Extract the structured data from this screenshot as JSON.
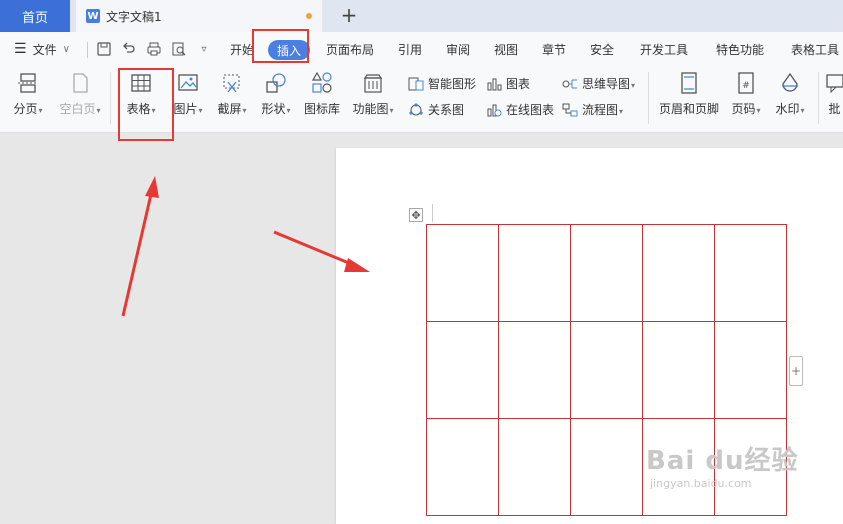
{
  "tabs": {
    "home": "首页",
    "doc_icon": "W",
    "doc_title": "文字文稿1",
    "add": "+"
  },
  "menubar": {
    "file_label": "文件",
    "items": [
      "开始",
      "插入",
      "页面布局",
      "引用",
      "审阅",
      "视图",
      "章节",
      "安全",
      "开发工具",
      "特色功能",
      "表格工具"
    ],
    "active_item": "插入"
  },
  "ribbon": {
    "page_break": "分页",
    "blank_page": "空白页",
    "table": "表格",
    "picture": "图片",
    "screenshot": "截屏",
    "shape": "形状",
    "icon_library": "图标库",
    "function_chart": "功能图",
    "smart_graphic": "智能图形",
    "chart": "图表",
    "mind_map": "思维导图",
    "relation_chart": "关系图",
    "online_chart": "在线图表",
    "flowchart": "流程图",
    "header_footer": "页眉和页脚",
    "page_number": "页码",
    "watermark": "水印",
    "comment": "批"
  },
  "document": {
    "table_rows": 3,
    "table_cols": 5,
    "table_border_color": "#c3353a",
    "add_column": "+"
  },
  "annotations": {
    "highlight_color": "#e53935"
  },
  "watermark": {
    "logo": "Bai du经验",
    "url": "jingyan.baidu.com"
  },
  "colors": {
    "accent": "#4b7fe2",
    "home_tab": "#3d6fd8"
  }
}
